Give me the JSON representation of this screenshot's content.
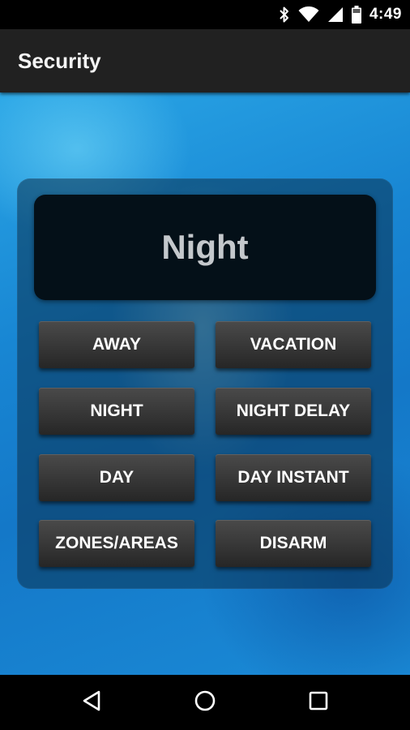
{
  "status_bar": {
    "time": "4:49",
    "icons": [
      "bluetooth-icon",
      "wifi-icon",
      "cell-signal-icon",
      "battery-icon"
    ]
  },
  "app_bar": {
    "title": "Security"
  },
  "panel": {
    "display_text": "Night",
    "buttons": [
      {
        "label": "AWAY"
      },
      {
        "label": "VACATION"
      },
      {
        "label": "NIGHT"
      },
      {
        "label": "NIGHT DELAY"
      },
      {
        "label": "DAY"
      },
      {
        "label": "DAY INSTANT"
      },
      {
        "label": "ZONES/AREAS"
      },
      {
        "label": "DISARM"
      }
    ]
  },
  "nav_bar": {
    "icons": [
      "back-icon",
      "home-icon",
      "recent-apps-icon"
    ]
  },
  "colors": {
    "status_bar_bg": "#000000",
    "app_bar_bg": "#212121",
    "background_blue": "#1886d3",
    "display_bg": "#041018",
    "display_text": "#c4c8cc",
    "button_bg": "#3a3a3a"
  }
}
